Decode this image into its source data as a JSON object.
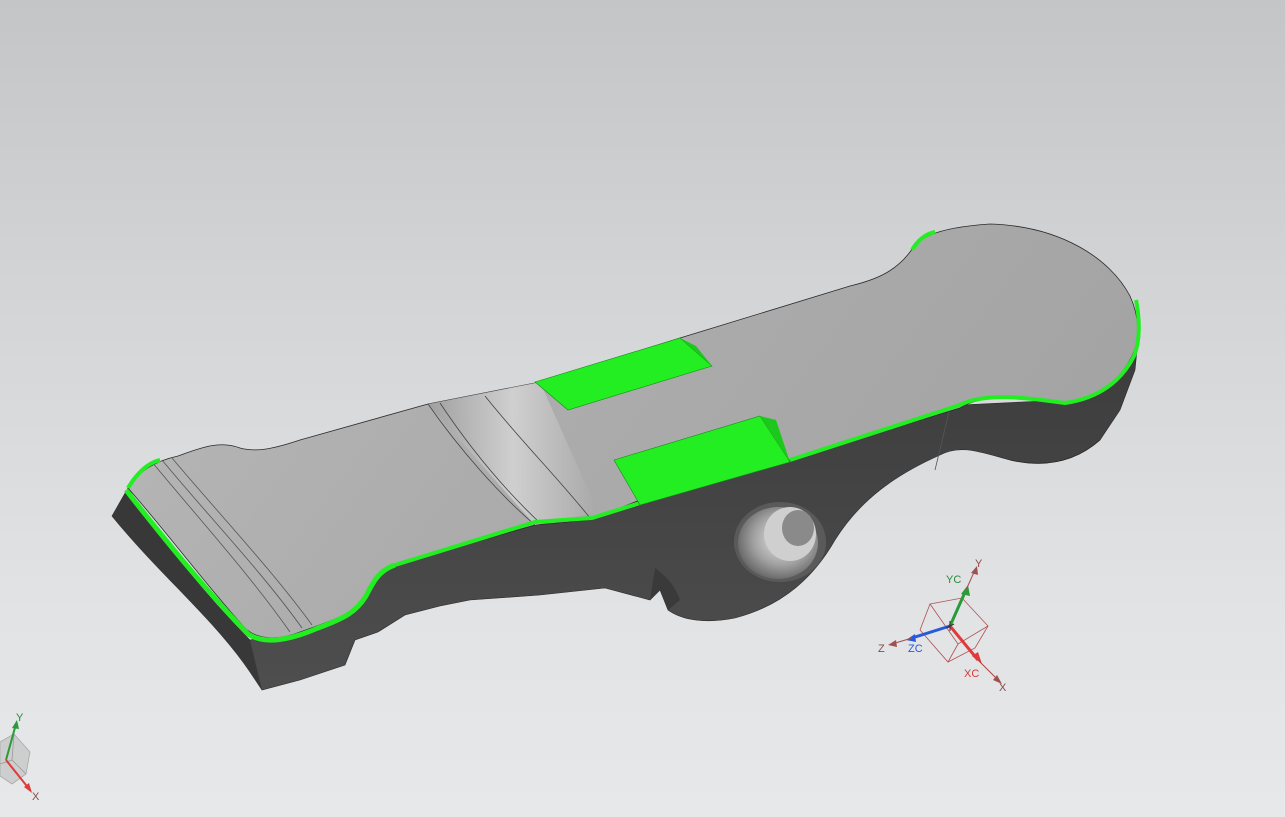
{
  "viewport": {
    "name": "3D modeling graphics window"
  },
  "csys": {
    "xc_label": "XC",
    "yc_label": "YC",
    "zc_label": "ZC",
    "x_label": "X",
    "y_label": "Y",
    "z_label": "Z"
  },
  "view_triad": {
    "x_label": "X",
    "y_label": "Y"
  },
  "colors": {
    "background_top": "#c4c5c7",
    "background_bottom": "#e6e8ea",
    "part_top_face": "#b4b4b4",
    "part_side_face": "#464646",
    "highlight_faces": "#22ee22",
    "xc_axis": "#e03a3a",
    "yc_axis": "#2a9a3a",
    "zc_axis": "#2a5ad8",
    "csys_box": "#b05050"
  }
}
